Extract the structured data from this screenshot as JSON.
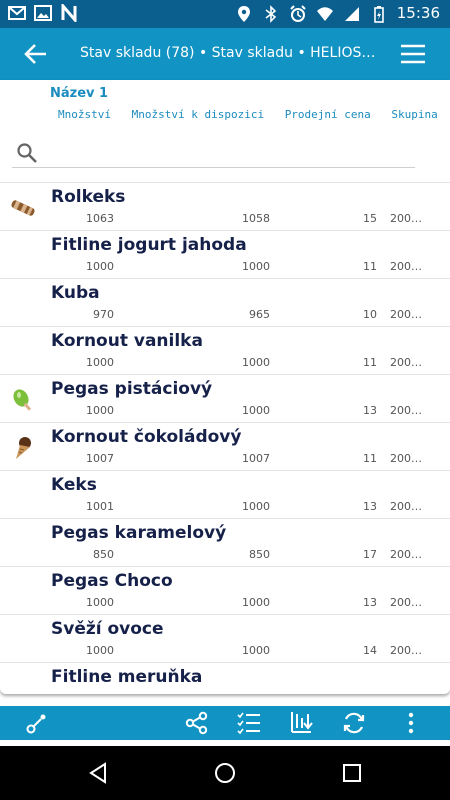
{
  "status": {
    "time": "15:36"
  },
  "header": {
    "title": "Stav skladu (78) • Stav skladu • HELIOS Or…"
  },
  "columns": {
    "primary": "Název 1",
    "secondary": [
      "Množství",
      "Množství k dispozici",
      "Prodejní cena",
      "Skupina"
    ]
  },
  "search": {
    "placeholder": ""
  },
  "items": [
    {
      "name": "Rolkeks",
      "qty": "1063",
      "available": "1058",
      "price": "15",
      "group": "200…",
      "thumb": "rolkeks"
    },
    {
      "name": "Fitline jogurt jahoda",
      "qty": "1000",
      "available": "1000",
      "price": "11",
      "group": "200…",
      "thumb": ""
    },
    {
      "name": "Kuba",
      "qty": "970",
      "available": "965",
      "price": "10",
      "group": "200…",
      "thumb": ""
    },
    {
      "name": "Kornout vanilka",
      "qty": "1000",
      "available": "1000",
      "price": "11",
      "group": "200…",
      "thumb": ""
    },
    {
      "name": "Pegas pistáciový",
      "qty": "1000",
      "available": "1000",
      "price": "13",
      "group": "200…",
      "thumb": "pistachio"
    },
    {
      "name": "Kornout čokoládový",
      "qty": "1007",
      "available": "1007",
      "price": "11",
      "group": "200…",
      "thumb": "cone"
    },
    {
      "name": "Keks",
      "qty": "1001",
      "available": "1000",
      "price": "13",
      "group": "200…",
      "thumb": ""
    },
    {
      "name": "Pegas karamelový",
      "qty": "850",
      "available": "850",
      "price": "17",
      "group": "200…",
      "thumb": ""
    },
    {
      "name": "Pegas Choco",
      "qty": "1000",
      "available": "1000",
      "price": "13",
      "group": "200…",
      "thumb": ""
    },
    {
      "name": "Svěží ovoce",
      "qty": "1000",
      "available": "1000",
      "price": "14",
      "group": "200…",
      "thumb": ""
    },
    {
      "name": "Fitline meruňka",
      "qty": "",
      "available": "",
      "price": "",
      "group": "",
      "thumb": ""
    }
  ],
  "toolbar": {
    "icons": [
      "connect-icon",
      "share-icon",
      "checklist-icon",
      "sort-icon",
      "refresh-icon",
      "more-vert-icon"
    ]
  },
  "nav": {
    "icons": [
      "back-triangle-icon",
      "home-circle-icon",
      "recents-square-icon"
    ]
  },
  "colors": {
    "statusbar": "#0a5f8f",
    "appbar": "#1193c4",
    "accent": "#1b8cbf",
    "itemText": "#16214a"
  }
}
